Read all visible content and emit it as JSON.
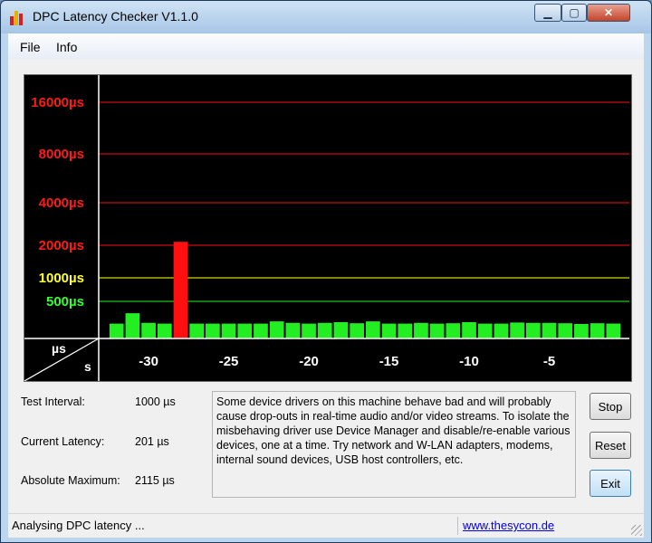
{
  "window": {
    "title": "DPC Latency Checker V1.1.0",
    "min_glyph": "▁",
    "max_glyph": "▢",
    "close_glyph": "✕"
  },
  "menu": {
    "file": "File",
    "info": "Info"
  },
  "chart_data": {
    "type": "bar",
    "y_tick_labels": [
      {
        "label": "16000µs",
        "value": 16000,
        "color": "#ff1a1a"
      },
      {
        "label": "8000µs",
        "value": 8000,
        "color": "#ff1a1a"
      },
      {
        "label": "4000µs",
        "value": 4000,
        "color": "#ff1a1a"
      },
      {
        "label": "2000µs",
        "value": 2000,
        "color": "#ff1a1a"
      },
      {
        "label": "1000µs",
        "value": 1000,
        "color": "#ffff33"
      },
      {
        "label": "500µs",
        "value": 500,
        "color": "#33ff33"
      }
    ],
    "x_tick_labels": [
      "-30",
      "-25",
      "-20",
      "-15",
      "-10",
      "-5"
    ],
    "x_ticks": [
      -30,
      -25,
      -20,
      -15,
      -10,
      -5
    ],
    "xlim": [
      -33,
      -1
    ],
    "corner_y_unit": "µs",
    "corner_x_unit": "s",
    "bar_x": [
      -32,
      -31,
      -30,
      -29,
      -28,
      -27,
      -26,
      -25,
      -24,
      -23,
      -22,
      -21,
      -20,
      -19,
      -18,
      -17,
      -16,
      -15,
      -14,
      -13,
      -12,
      -11,
      -10,
      -9,
      -8,
      -7,
      -6,
      -5,
      -4,
      -3,
      -2,
      -1
    ],
    "bar_values": [
      200,
      340,
      210,
      200,
      2115,
      200,
      200,
      200,
      200,
      200,
      230,
      210,
      200,
      210,
      220,
      205,
      230,
      200,
      200,
      210,
      200,
      205,
      220,
      200,
      200,
      215,
      210,
      210,
      205,
      195,
      205,
      201
    ],
    "colors": {
      "ok": "#22ee22",
      "warn": "#ffff33",
      "bad": "#ff1010",
      "grid_red": "#c41010",
      "grid_yellow": "#d4d400",
      "grid_green": "#20c020"
    }
  },
  "info": {
    "test_interval_label": "Test Interval:",
    "test_interval_value": "1000 µs",
    "current_latency_label": "Current Latency:",
    "current_latency_value": "201 µs",
    "absolute_max_label": "Absolute Maximum:",
    "absolute_max_value": "2115 µs"
  },
  "message": "Some device drivers on this machine behave bad and will probably cause drop-outs in real-time audio and/or video streams. To isolate the misbehaving driver use Device Manager and disable/re-enable various devices, one at a time. Try network and W-LAN adapters, modems, internal sound devices, USB host controllers, etc.",
  "buttons": {
    "stop": "Stop",
    "reset": "Reset",
    "exit": "Exit"
  },
  "status": {
    "text": "Analysing DPC latency ...",
    "link": "www.thesycon.de"
  }
}
